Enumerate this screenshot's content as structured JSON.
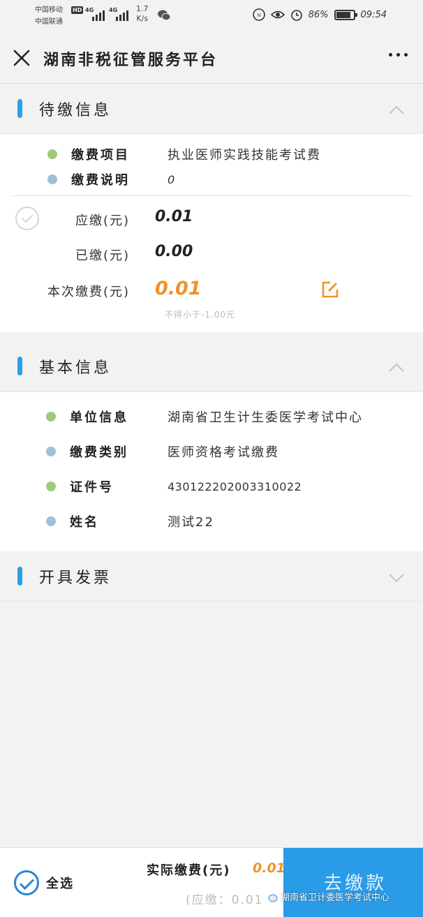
{
  "status_bar": {
    "carrier_1": "中国移动",
    "carrier_2": "中国联通",
    "hd": "HD",
    "net_1": "4G",
    "net_2": "4G",
    "speed_value": "1.7",
    "speed_unit": "K/s",
    "battery": "86%",
    "time": "09:54"
  },
  "nav": {
    "title": "湖南非税征管服务平台",
    "close_icon": "close-icon",
    "more_icon": "more-dots-icon"
  },
  "pending": {
    "title": "待缴信息",
    "collapsed": false,
    "item_label": "缴费项目",
    "item_value": "执业医师实践技能考试费",
    "desc_label": "缴费说明",
    "desc_value": "0",
    "due_label": "应缴(元)",
    "due_value": "0.01",
    "paid_label": "已缴(元)",
    "paid_value": "0.00",
    "current_label": "本次缴费(元)",
    "current_value": "0.01",
    "hint": "不得小于-1.00元"
  },
  "basic": {
    "title": "基本信息",
    "collapsed": false,
    "rows": [
      {
        "label": "单位信息",
        "value": "湖南省卫生计生委医学考试中心"
      },
      {
        "label": "缴费类别",
        "value": "医师资格考试缴费"
      },
      {
        "label": "证件号",
        "value": "430122202003310022"
      },
      {
        "label": "姓名",
        "value": "测试22"
      }
    ]
  },
  "invoice": {
    "title": "开具发票",
    "collapsed": true
  },
  "bottom": {
    "select_all": "全选",
    "actual_label": "实际缴费(元)",
    "actual_value": "0.01",
    "due_note": "(应缴：0.01",
    "pay_button": "去缴款",
    "watermark": "湖南省卫计委医学考试中心"
  },
  "colors": {
    "accent_blue": "#2aa0e6",
    "amount_orange": "#f0922a",
    "dot_green": "#9fca7c",
    "dot_blue": "#9ec1d6"
  }
}
